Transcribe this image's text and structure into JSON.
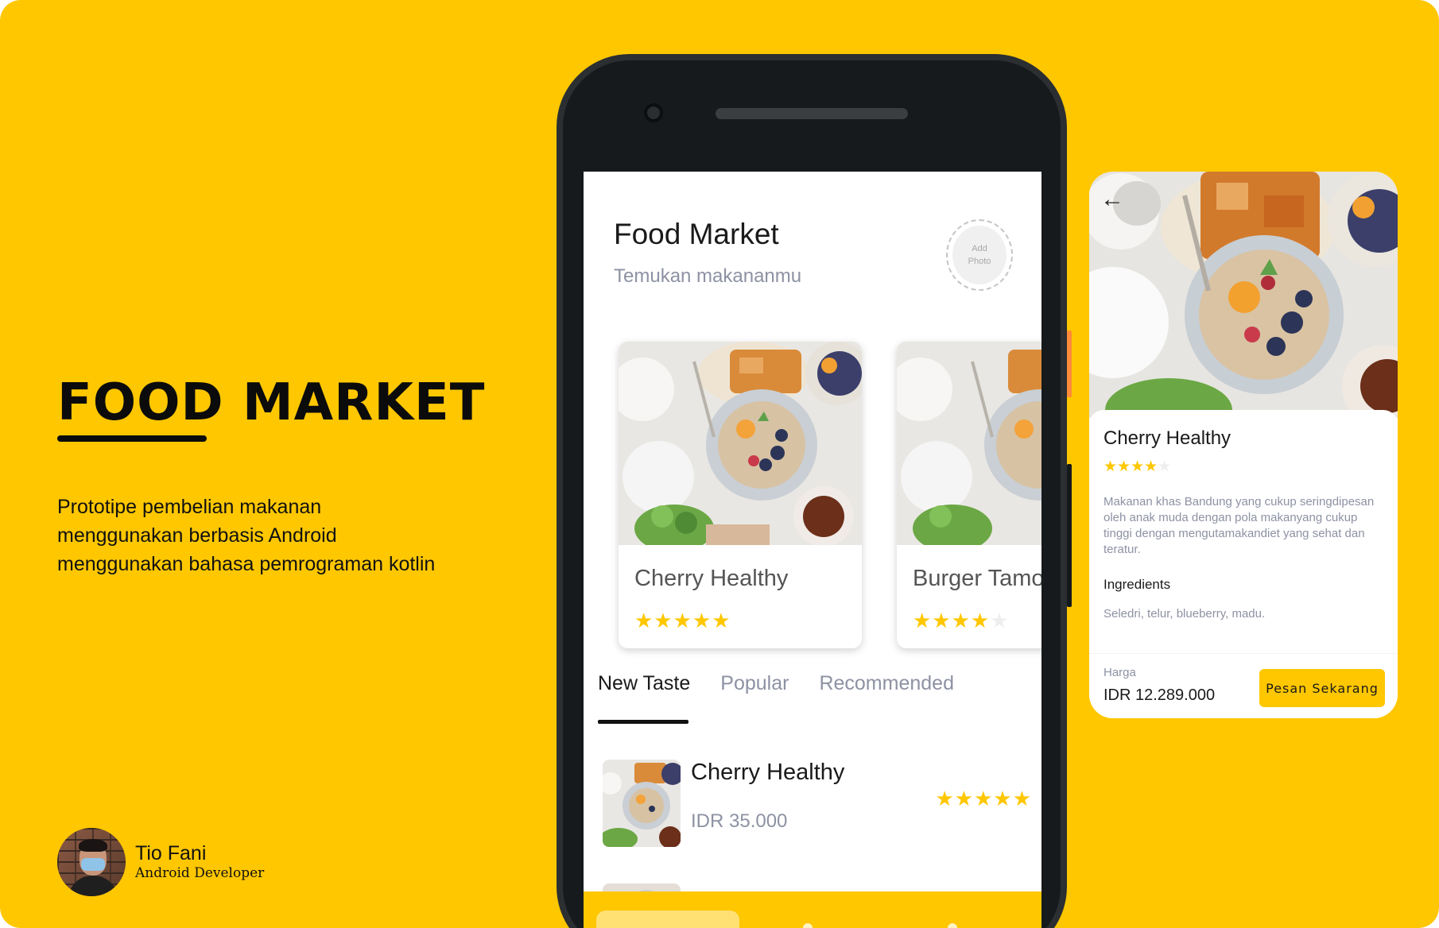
{
  "brand": {
    "title_part1": "FOOD",
    "title_part2": " MARKET",
    "description": "Prototipe pembelian makanan menggunakan berbasis Android menggunakan bahasa pemrograman kotlin",
    "background_color": "#ffc700"
  },
  "author": {
    "name": "Tio Fani",
    "role": "Android Developer"
  },
  "app": {
    "title": "Food Market",
    "subtitle": "Temukan makananmu",
    "add_photo_line1": "Add",
    "add_photo_line2": "Photo",
    "featured": [
      {
        "name": "Cherry Healthy",
        "stars": "★★★★★",
        "rating": 5
      },
      {
        "name": "Burger Tamo",
        "stars": "★★★★",
        "stars_off": "★",
        "rating": 4
      }
    ],
    "tabs": [
      "New Taste",
      "Popular",
      "Recommended"
    ],
    "active_tab": "New Taste",
    "list": [
      {
        "name": "Cherry Healthy",
        "price": "IDR 35.000",
        "stars": "★★★★★",
        "rating": 5
      }
    ]
  },
  "detail": {
    "back_icon": "←",
    "name": "Cherry Healthy",
    "stars": "★★★★",
    "stars_off": "★",
    "rating": 4,
    "description": "Makanan khas Bandung yang cukup seringdipesan oleh anak muda dengan pola makanyang cukup tinggi dengan mengutamakandiet yang sehat dan teratur.",
    "ingredients_title": "Ingredients",
    "ingredients": "Seledri, telur, blueberry, madu.",
    "price_label": "Harga",
    "price": "IDR 12.289.000",
    "order_label": "Pesan Sekarang"
  }
}
